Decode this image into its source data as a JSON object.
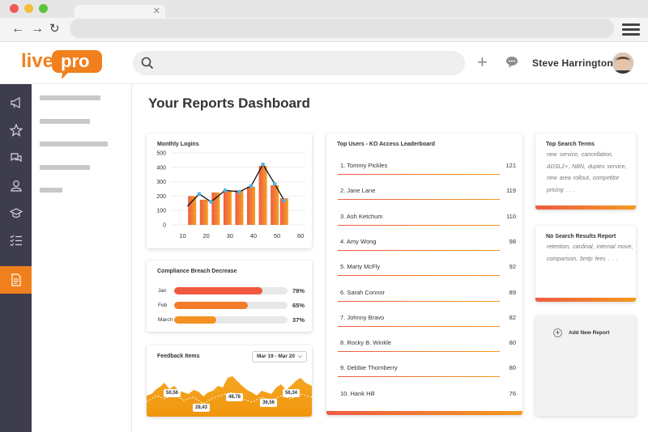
{
  "app": {
    "user_name": "Steve  Harrington",
    "search_placeholder": ""
  },
  "page": {
    "title": "Your Reports Dashboard"
  },
  "monthly_logins": {
    "title": "Monthly Logins",
    "chart_data": {
      "type": "bar",
      "x": [
        10,
        20,
        30,
        40,
        50,
        60
      ],
      "xticks": [
        "10",
        "20",
        "30",
        "40",
        "50",
        "60"
      ],
      "yticks": [
        "0",
        "100",
        "200",
        "300",
        "400",
        "500"
      ],
      "ylim": [
        0,
        500
      ],
      "bars": [
        {
          "x": 14,
          "value": 200
        },
        {
          "x": 19,
          "value": 175
        },
        {
          "x": 24,
          "value": 225
        },
        {
          "x": 29,
          "value": 235
        },
        {
          "x": 34,
          "value": 240
        },
        {
          "x": 39,
          "value": 265
        },
        {
          "x": 44,
          "value": 410
        },
        {
          "x": 49,
          "value": 275
        },
        {
          "x": 53,
          "value": 185
        }
      ],
      "line": [
        {
          "x": 12,
          "y": 130
        },
        {
          "x": 17,
          "y": 215
        },
        {
          "x": 22,
          "y": 160
        },
        {
          "x": 28,
          "y": 240
        },
        {
          "x": 34,
          "y": 230
        },
        {
          "x": 39,
          "y": 270
        },
        {
          "x": 44,
          "y": 420
        },
        {
          "x": 49,
          "y": 285
        },
        {
          "x": 53,
          "y": 170
        }
      ],
      "colors": {
        "bar_start": "#f15a47",
        "bar_end": "#f4a024",
        "line": "#111111",
        "point": "#4fb3e3"
      }
    }
  },
  "compliance": {
    "title": "Compliance Breach Decrease",
    "items": [
      {
        "label": "Jan",
        "pct": "78%",
        "value": 0.78,
        "color": "#ef5940"
      },
      {
        "label": "Feb",
        "pct": "65%",
        "value": 0.65,
        "color": "#f27c2b"
      },
      {
        "label": "March",
        "pct": "37%",
        "value": 0.37,
        "color": "#f39021"
      }
    ]
  },
  "feedback": {
    "title": "Feedback Items",
    "date_range": "Mar 19 - Mar 20",
    "labels": [
      "50,56",
      "28,43",
      "48,78",
      "36,56",
      "56,34"
    ]
  },
  "leaderboard": {
    "title": "Top Users - KO Access Leaderboard",
    "rows": [
      {
        "name": "1. Tommy Pickles",
        "score": "121"
      },
      {
        "name": "2. Jane Lane",
        "score": "119"
      },
      {
        "name": "3. Ash Ketchum",
        "score": "110"
      },
      {
        "name": "4. Amy Wong",
        "score": "98"
      },
      {
        "name": "5. Marty McFly",
        "score": "92"
      },
      {
        "name": "6. Sarah Connor",
        "score": "89"
      },
      {
        "name": "7. Johnny Bravo",
        "score": "82"
      },
      {
        "name": "8. Rocky B. Winkle",
        "score": "80"
      },
      {
        "name": "9. Debbie Thornberry",
        "score": "80"
      },
      {
        "name": "10. Hank Hill",
        "score": "76"
      }
    ]
  },
  "top_search": {
    "title": "Top Search Terms",
    "terms": "new service,   cancellation,  ADSL2+,   NBN,   duplex service,  new area rollout,   competitor pricing . . ."
  },
  "no_results": {
    "title": "No Search Results Report",
    "terms": "retention,   cardinal,   internal move,   comparison,  bmtp fees . . ."
  },
  "add_report": {
    "label": "Add New Report"
  }
}
